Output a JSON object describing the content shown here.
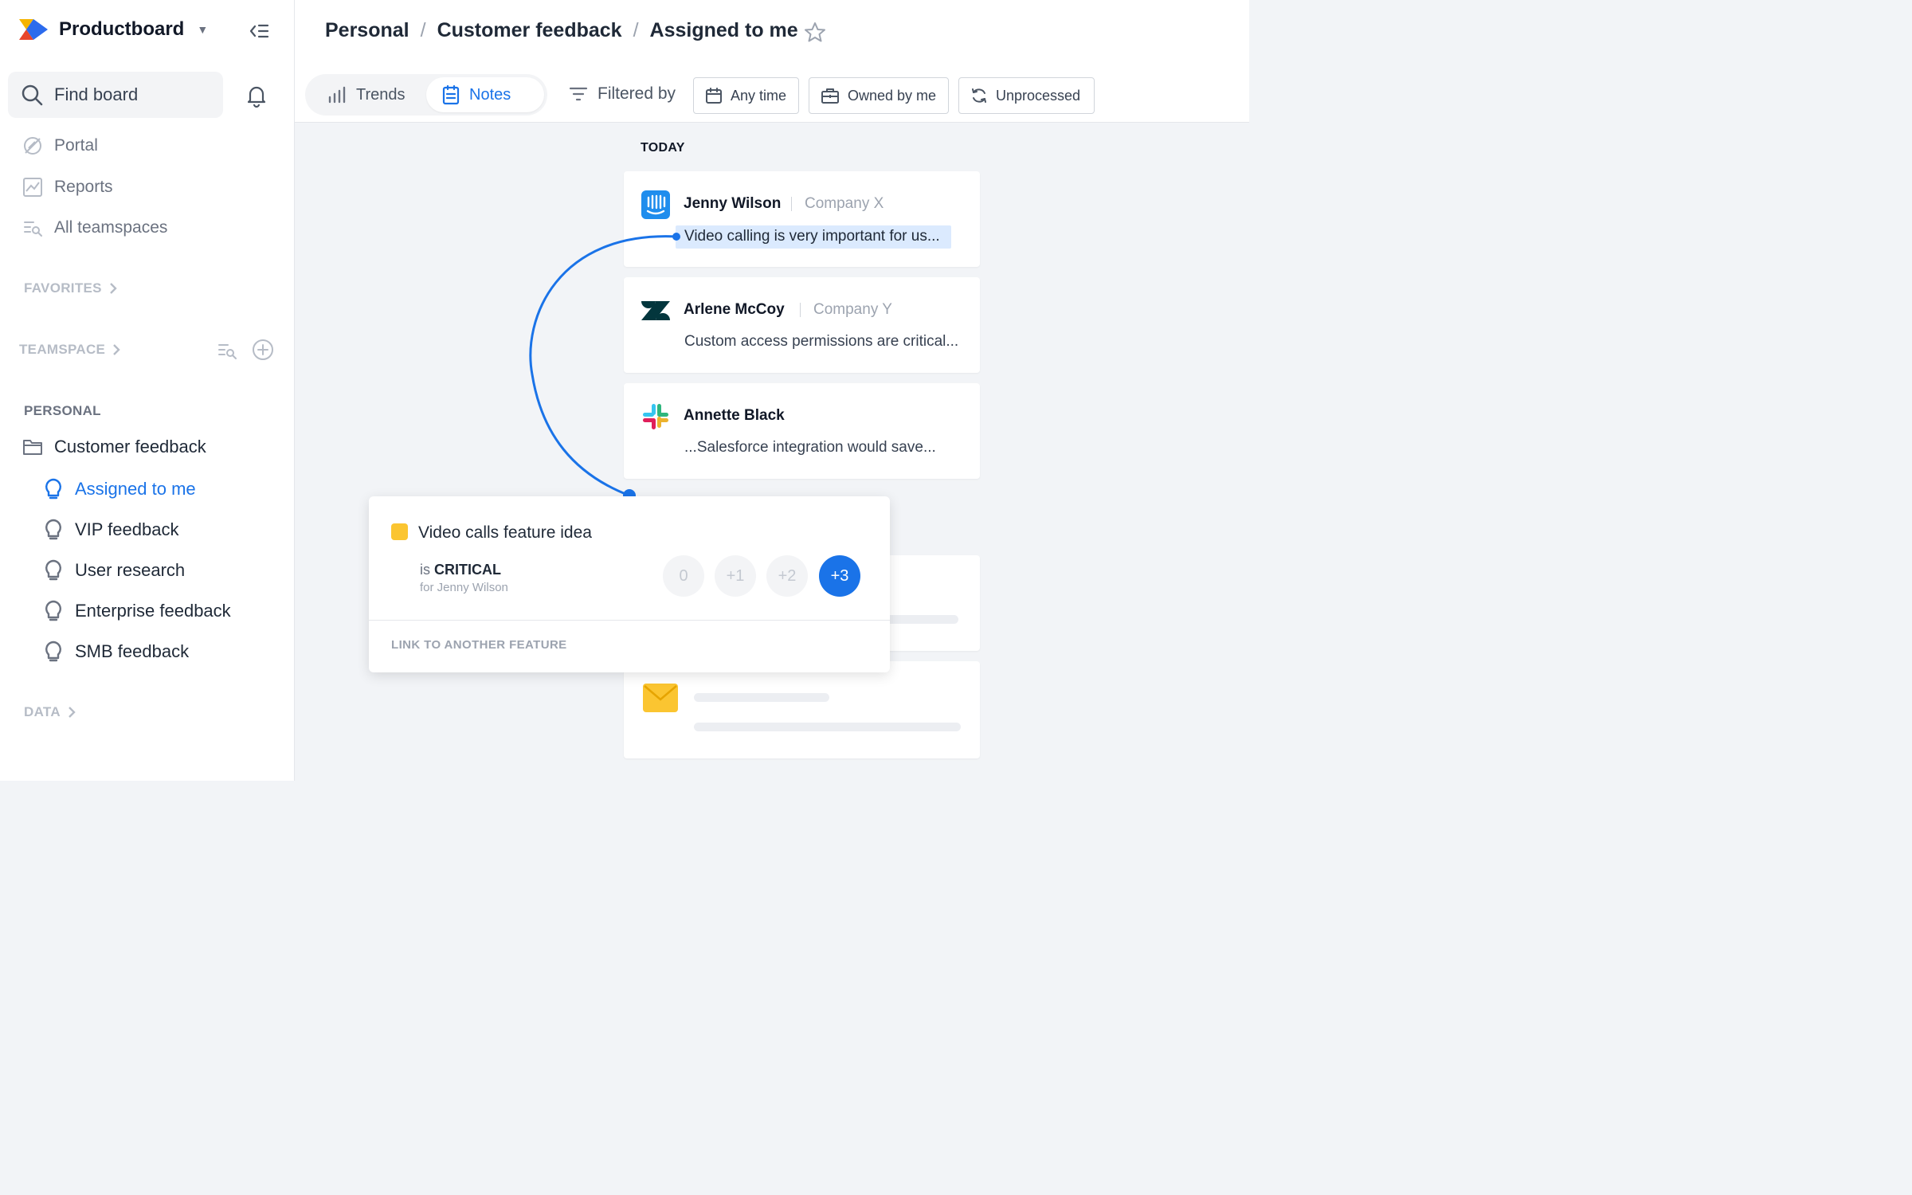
{
  "brand": {
    "name": "Productboard"
  },
  "search": {
    "label": "Find board"
  },
  "nav": {
    "portal": "Portal",
    "reports": "Reports",
    "all_teamspaces": "All teamspaces"
  },
  "sections": {
    "favorites": "FAVORITES",
    "teamspace": "TEAMSPACE",
    "personal": "PERSONAL",
    "data": "DATA"
  },
  "personal": {
    "folder": "Customer feedback",
    "items": [
      {
        "label": "Assigned to me",
        "active": true
      },
      {
        "label": "VIP feedback"
      },
      {
        "label": "User research"
      },
      {
        "label": "Enterprise feedback"
      },
      {
        "label": "SMB feedback"
      }
    ]
  },
  "breadcrumb": {
    "root": "Personal",
    "folder": "Customer feedback",
    "current": "Assigned to me",
    "separator": "/"
  },
  "toolbar": {
    "trends": "Trends",
    "notes": "Notes",
    "filtered_by": "Filtered by",
    "chips": {
      "time": "Any time",
      "owner": "Owned by me",
      "status": "Unprocessed"
    }
  },
  "feed": {
    "group": "TODAY",
    "notes": [
      {
        "name": "Jenny Wilson",
        "company": "Company X",
        "snippet": "Video calling is very important for us...",
        "source": "intercom-icon"
      },
      {
        "name": "Arlene McCoy",
        "company": "Company Y",
        "snippet": "Custom access permissions are critical...",
        "source": "zendesk-icon"
      },
      {
        "name": "Annette Black",
        "company": "",
        "snippet": "...Salesforce integration would save...",
        "source": "slack-icon"
      }
    ]
  },
  "popover": {
    "title": "Video calls feature idea",
    "is_prefix": "is",
    "importance": "CRITICAL",
    "for_text": "for Jenny Wilson",
    "votes": [
      "0",
      "+1",
      "+2",
      "+3"
    ],
    "selected_vote": "+3",
    "link_text": "LINK TO ANOTHER FEATURE"
  },
  "colors": {
    "accent": "#1a73e8",
    "feature": "#fbc531",
    "highlight": "#dbeafe"
  }
}
